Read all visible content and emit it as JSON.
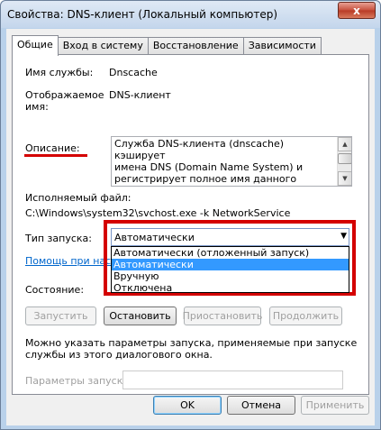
{
  "window": {
    "title": "Свойства: DNS-клиент (Локальный компьютер)",
    "close_label": "x"
  },
  "tabs": [
    {
      "label": "Общие"
    },
    {
      "label": "Вход в систему"
    },
    {
      "label": "Восстановление"
    },
    {
      "label": "Зависимости"
    }
  ],
  "general": {
    "service_name_label": "Имя службы:",
    "service_name_value": "Dnscache",
    "display_name_label": "Отображаемое\nимя:",
    "display_name_value": "DNS-клиент",
    "description_label": "Описание:",
    "description_value": "Служба DNS-клиента (dnscache) кэширует\nимена DNS (Domain Name System) и\nрегистрирует полное имя данного компьютера.\nЕсли служба остановлена, разрешение имен",
    "exe_label": "Исполняемый файл:",
    "exe_value": "C:\\Windows\\system32\\svchost.exe -k NetworkService",
    "startup_type_label": "Тип запуска:",
    "startup_type_value": "Автоматически",
    "startup_options": [
      "Автоматически (отложенный запуск)",
      "Автоматически",
      "Вручную",
      "Отключена"
    ],
    "selected_option_index": 1,
    "help_link": "Помощь при нас",
    "state_label": "Состояние:",
    "buttons": {
      "start": "Запустить",
      "stop": "Остановить",
      "pause": "Приостановить",
      "resume": "Продолжить"
    },
    "hint": "Можно указать параметры запуска, применяемые при запуске\nслужбы из этого диалогового окна.",
    "params_label": "Параметры запуска:",
    "params_value": ""
  },
  "dialog_buttons": {
    "ok": "OK",
    "cancel": "Отмена",
    "apply": "Применить"
  },
  "colors": {
    "highlight": "#d40000",
    "selection": "#3399ff",
    "link": "#0066cc"
  }
}
